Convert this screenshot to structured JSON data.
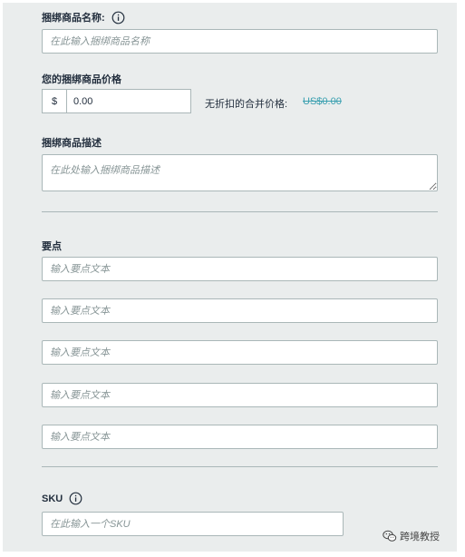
{
  "bundle_name": {
    "label": "捆绑商品名称:",
    "placeholder": "在此输入捆绑商品名称",
    "info_icon": "info-circle-icon"
  },
  "bundle_price": {
    "label": "您的捆绑商品价格",
    "currency_symbol": "$",
    "value": "0.00",
    "combined_label": "无折扣的合并价格:",
    "combined_value": "US$0.00"
  },
  "bundle_description": {
    "label": "捆绑商品描述",
    "placeholder": "在此处输入捆绑商品描述"
  },
  "key_points": {
    "label": "要点",
    "items": [
      {
        "placeholder": "输入要点文本"
      },
      {
        "placeholder": "输入要点文本"
      },
      {
        "placeholder": "输入要点文本"
      },
      {
        "placeholder": "输入要点文本"
      },
      {
        "placeholder": "输入要点文本"
      }
    ]
  },
  "sku": {
    "label": "SKU",
    "placeholder": "在此输入一个SKU",
    "info_icon": "info-circle-icon"
  },
  "watermark": {
    "text": "跨境教授",
    "icon": "wechat-icon"
  },
  "colors": {
    "panel_background": "#eaeded",
    "border": "#aab7b8",
    "text": "#232f3e",
    "placeholder": "#879596",
    "accent": "#3aa0b0"
  }
}
